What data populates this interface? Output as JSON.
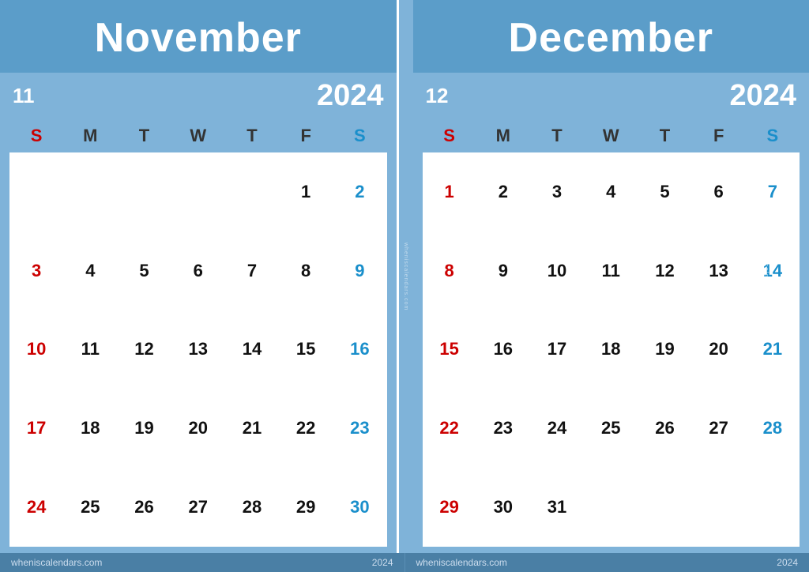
{
  "november": {
    "title": "November",
    "month_number": "11",
    "year": "2024",
    "day_headers": [
      "S",
      "M",
      "T",
      "W",
      "T",
      "F",
      "S"
    ],
    "days": [
      {
        "day": "",
        "type": "empty"
      },
      {
        "day": "",
        "type": "empty"
      },
      {
        "day": "",
        "type": "empty"
      },
      {
        "day": "",
        "type": "empty"
      },
      {
        "day": "",
        "type": "empty"
      },
      {
        "day": "1",
        "type": "weekday"
      },
      {
        "day": "2",
        "type": "saturday"
      },
      {
        "day": "3",
        "type": "sunday"
      },
      {
        "day": "4",
        "type": "weekday"
      },
      {
        "day": "5",
        "type": "weekday"
      },
      {
        "day": "6",
        "type": "weekday"
      },
      {
        "day": "7",
        "type": "weekday"
      },
      {
        "day": "8",
        "type": "weekday"
      },
      {
        "day": "9",
        "type": "saturday"
      },
      {
        "day": "10",
        "type": "sunday"
      },
      {
        "day": "11",
        "type": "weekday"
      },
      {
        "day": "12",
        "type": "weekday"
      },
      {
        "day": "13",
        "type": "weekday"
      },
      {
        "day": "14",
        "type": "weekday"
      },
      {
        "day": "15",
        "type": "weekday"
      },
      {
        "day": "16",
        "type": "saturday"
      },
      {
        "day": "17",
        "type": "sunday"
      },
      {
        "day": "18",
        "type": "weekday"
      },
      {
        "day": "19",
        "type": "weekday"
      },
      {
        "day": "20",
        "type": "weekday"
      },
      {
        "day": "21",
        "type": "weekday"
      },
      {
        "day": "22",
        "type": "weekday"
      },
      {
        "day": "23",
        "type": "saturday"
      },
      {
        "day": "24",
        "type": "sunday"
      },
      {
        "day": "25",
        "type": "weekday"
      },
      {
        "day": "26",
        "type": "weekday"
      },
      {
        "day": "27",
        "type": "weekday"
      },
      {
        "day": "28",
        "type": "weekday"
      },
      {
        "day": "29",
        "type": "weekday"
      },
      {
        "day": "30",
        "type": "saturday"
      }
    ]
  },
  "december": {
    "title": "December",
    "month_number": "12",
    "year": "2024",
    "day_headers": [
      "S",
      "M",
      "T",
      "W",
      "T",
      "F",
      "S"
    ],
    "days": [
      {
        "day": "1",
        "type": "sunday"
      },
      {
        "day": "2",
        "type": "weekday"
      },
      {
        "day": "3",
        "type": "weekday"
      },
      {
        "day": "4",
        "type": "weekday"
      },
      {
        "day": "5",
        "type": "weekday"
      },
      {
        "day": "6",
        "type": "weekday"
      },
      {
        "day": "7",
        "type": "saturday"
      },
      {
        "day": "8",
        "type": "sunday"
      },
      {
        "day": "9",
        "type": "weekday"
      },
      {
        "day": "10",
        "type": "weekday"
      },
      {
        "day": "11",
        "type": "weekday"
      },
      {
        "day": "12",
        "type": "weekday"
      },
      {
        "day": "13",
        "type": "weekday"
      },
      {
        "day": "14",
        "type": "saturday"
      },
      {
        "day": "15",
        "type": "sunday"
      },
      {
        "day": "16",
        "type": "weekday"
      },
      {
        "day": "17",
        "type": "weekday"
      },
      {
        "day": "18",
        "type": "weekday"
      },
      {
        "day": "19",
        "type": "weekday"
      },
      {
        "day": "20",
        "type": "weekday"
      },
      {
        "day": "21",
        "type": "saturday"
      },
      {
        "day": "22",
        "type": "sunday"
      },
      {
        "day": "23",
        "type": "weekday"
      },
      {
        "day": "24",
        "type": "weekday"
      },
      {
        "day": "25",
        "type": "weekday"
      },
      {
        "day": "26",
        "type": "weekday"
      },
      {
        "day": "27",
        "type": "weekday"
      },
      {
        "day": "28",
        "type": "saturday"
      },
      {
        "day": "29",
        "type": "sunday"
      },
      {
        "day": "30",
        "type": "weekday"
      },
      {
        "day": "31",
        "type": "weekday"
      },
      {
        "day": "",
        "type": "empty"
      },
      {
        "day": "",
        "type": "empty"
      },
      {
        "day": "",
        "type": "empty"
      },
      {
        "day": "",
        "type": "empty"
      }
    ]
  },
  "footer": {
    "left_site": "wheniscalendars.com",
    "left_year": "2024",
    "right_site": "wheniscalendars.com",
    "right_year": "2024"
  },
  "watermark": "wheniscalendars.com"
}
